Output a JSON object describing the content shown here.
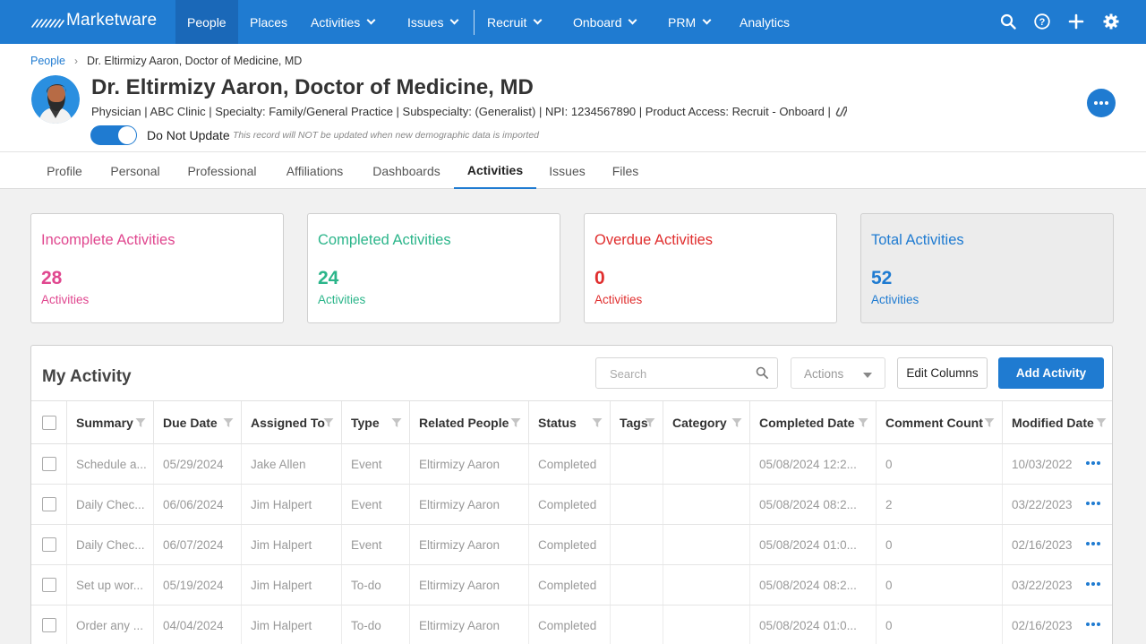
{
  "brand": {
    "name": "Marketware",
    "accent": "#1f7bd1"
  },
  "nav": {
    "items": [
      {
        "label": "People",
        "dropdown": false,
        "active": true
      },
      {
        "label": "Places",
        "dropdown": false
      },
      {
        "label": "Activities",
        "dropdown": true
      },
      {
        "label": "Issues",
        "dropdown": true
      },
      {
        "label": "Recruit",
        "dropdown": true
      },
      {
        "label": "Onboard",
        "dropdown": true
      },
      {
        "label": "PRM",
        "dropdown": true
      },
      {
        "label": "Analytics",
        "dropdown": false
      }
    ],
    "icons": [
      "search-icon",
      "help-icon",
      "plus-icon",
      "gear-icon"
    ]
  },
  "breadcrumb": {
    "root": "People",
    "current": "Dr. Eltirmizy Aaron, Doctor of Medicine, MD"
  },
  "person": {
    "name": "Dr. Eltirmizy Aaron, Doctor of Medicine, MD",
    "subtitle": "Physician | ABC Clinic | Specialty: Family/General Practice | Subspecialty: (Generalist) | NPI: 1234567890 | Product Access: Recruit - Onboard |",
    "do_not_update_label": "Do Not Update",
    "do_not_update_note": "This record will NOT be updated when new demographic data is imported",
    "do_not_update_on": true
  },
  "tabs": [
    "Profile",
    "Personal",
    "Professional",
    "Affiliations",
    "Dashboards",
    "Activities",
    "Issues",
    "Files"
  ],
  "active_tab": "Activities",
  "stats": [
    {
      "title": "Incomplete Activities",
      "value": "28",
      "unit": "Activities",
      "color": "#e0478f"
    },
    {
      "title": "Completed Activities",
      "value": "24",
      "unit": "Activities",
      "color": "#2bb58a"
    },
    {
      "title": "Overdue Activities",
      "value": "0",
      "unit": "Activities",
      "color": "#e02e2e"
    },
    {
      "title": "Total Activities",
      "value": "52",
      "unit": "Activities",
      "color": "#1f7bd1"
    }
  ],
  "my_activity": {
    "title": "My Activity",
    "search_placeholder": "Search",
    "actions_label": "Actions",
    "edit_columns_label": "Edit Columns",
    "add_activity_label": "Add Activity",
    "columns": [
      "Summary",
      "Due Date",
      "Assigned To",
      "Type",
      "Related People",
      "Status",
      "Tags",
      "Category",
      "Completed Date",
      "Comment Count",
      "Modified Date"
    ],
    "rows": [
      [
        "Schedule a...",
        "05/29/2024",
        "Jake Allen",
        "Event",
        "Eltirmizy Aaron",
        "Completed",
        "",
        "",
        "05/08/2024 12:2...",
        "0",
        "10/03/2022"
      ],
      [
        "Daily Chec...",
        "06/06/2024",
        "Jim Halpert",
        "Event",
        "Eltirmizy Aaron",
        "Completed",
        "",
        "",
        "05/08/2024 08:2...",
        "2",
        "03/22/2023"
      ],
      [
        "Daily Chec...",
        "06/07/2024",
        "Jim Halpert",
        "Event",
        "Eltirmizy Aaron",
        "Completed",
        "",
        "",
        "05/08/2024 01:0...",
        "0",
        "02/16/2023"
      ],
      [
        "Set up wor...",
        "05/19/2024",
        "Jim Halpert",
        "To-do",
        "Eltirmizy Aaron",
        "Completed",
        "",
        "",
        "05/08/2024 08:2...",
        "0",
        "03/22/2023"
      ],
      [
        "Order any ...",
        "04/04/2024",
        "Jim Halpert",
        "To-do",
        "Eltirmizy Aaron",
        "Completed",
        "",
        "",
        "05/08/2024 01:0...",
        "0",
        "02/16/2023"
      ]
    ]
  }
}
